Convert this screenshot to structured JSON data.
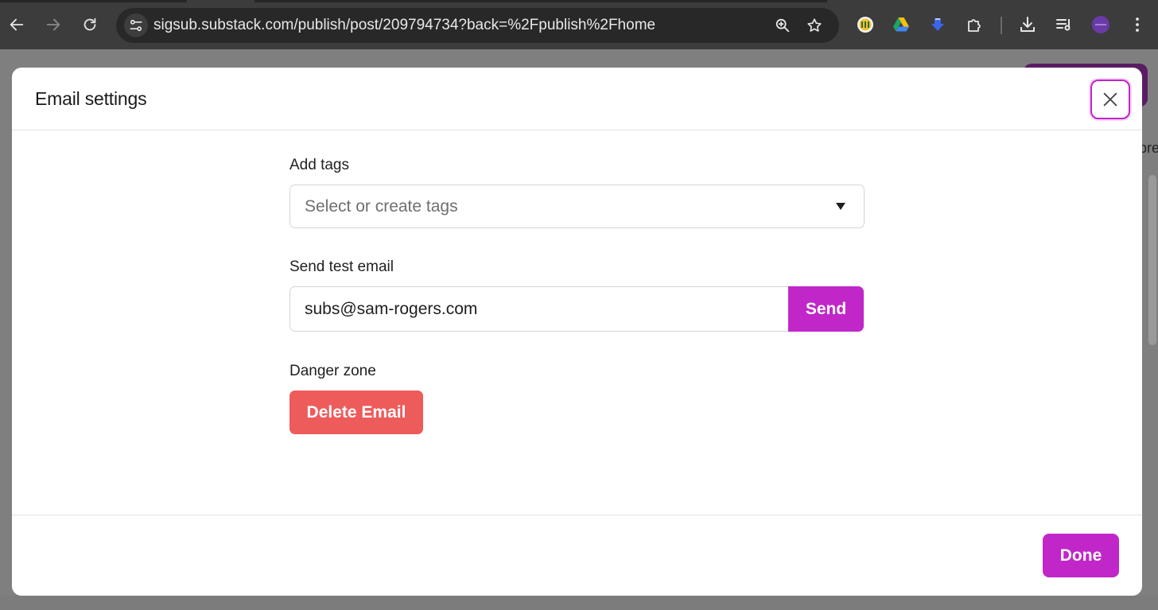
{
  "browser": {
    "url": "sigsub.substack.com/publish/post/209794734?back=%2Fpublish%2Fhome",
    "icons": [
      "back-arrow-icon",
      "forward-arrow-icon",
      "reload-icon",
      "site-info-icon",
      "zoom-icon",
      "bookmark-star-icon",
      "extension-icon",
      "google-drive-icon",
      "download-arrow-icon",
      "puzzle-icon",
      "downloads-icon",
      "reading-list-icon",
      "profile-avatar",
      "kebab-menu-icon"
    ]
  },
  "background": {
    "partial_text": "pre"
  },
  "modal": {
    "title": "Email settings",
    "tags": {
      "label": "Add tags",
      "placeholder": "Select or create tags"
    },
    "test_email": {
      "label": "Send test email",
      "value": "subs@sam-rogers.com",
      "send_label": "Send"
    },
    "danger": {
      "label": "Danger zone",
      "delete_label": "Delete Email"
    },
    "done_label": "Done"
  },
  "colors": {
    "accent": "#c126c9",
    "danger": "#ee5b5b",
    "toolbar": "#3c3c3c"
  }
}
